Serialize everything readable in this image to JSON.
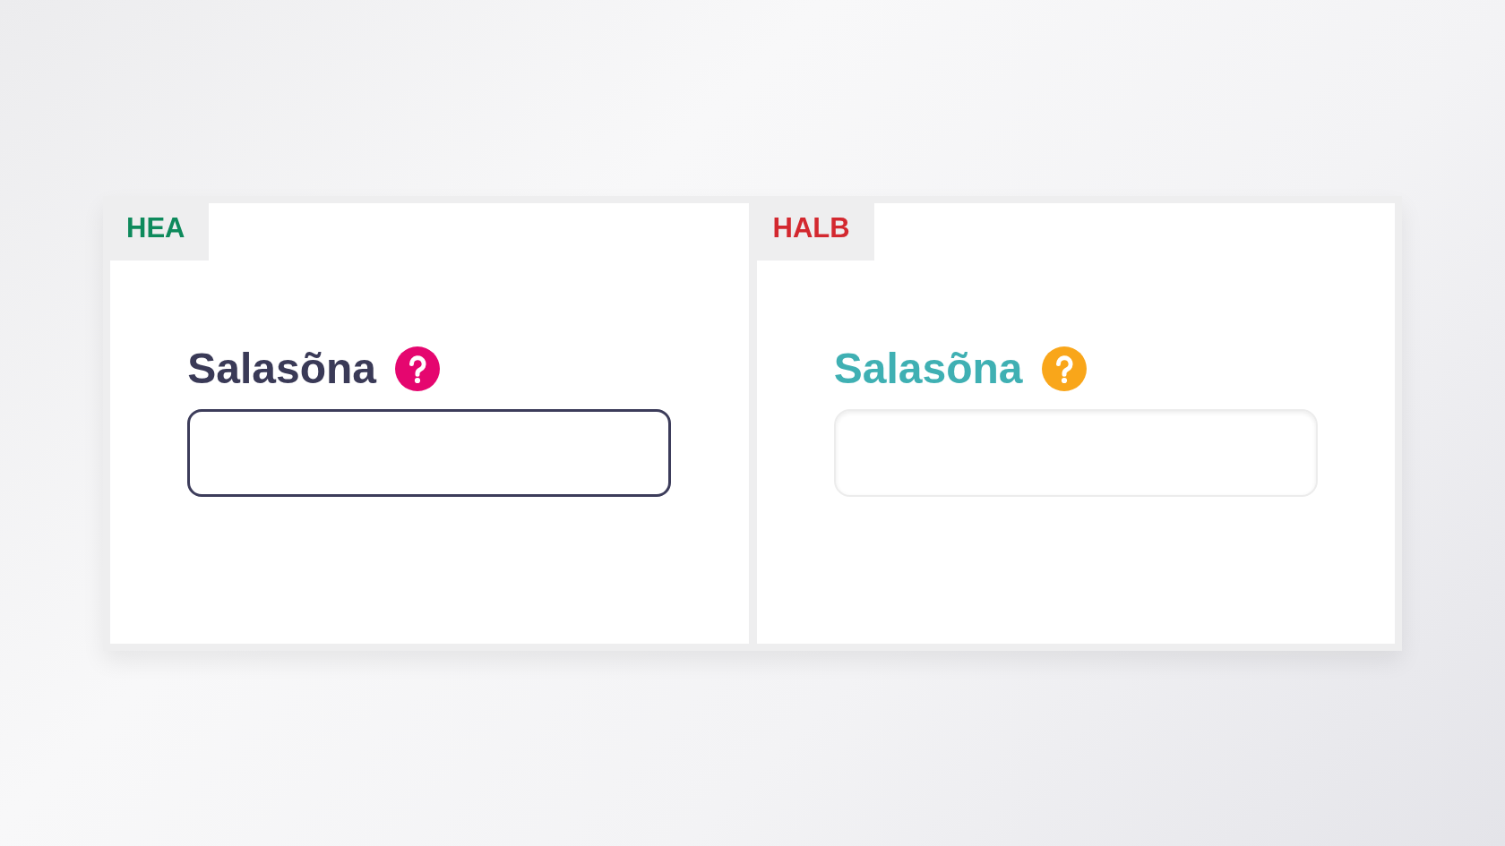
{
  "panels": [
    {
      "tab": {
        "label": "HEA",
        "color": "#0e8a5c"
      },
      "field": {
        "kind": "outlined",
        "label": {
          "text": "Salasõna",
          "color": "#3a3a57"
        },
        "help_icon": {
          "color": "#e5066f"
        }
      }
    },
    {
      "tab": {
        "label": "HALB",
        "color": "#d3282f"
      },
      "field": {
        "kind": "soft",
        "label": {
          "text": "Salasõna",
          "color": "#3fb0b3"
        },
        "help_icon": {
          "color": "#f9a61a"
        }
      }
    }
  ]
}
